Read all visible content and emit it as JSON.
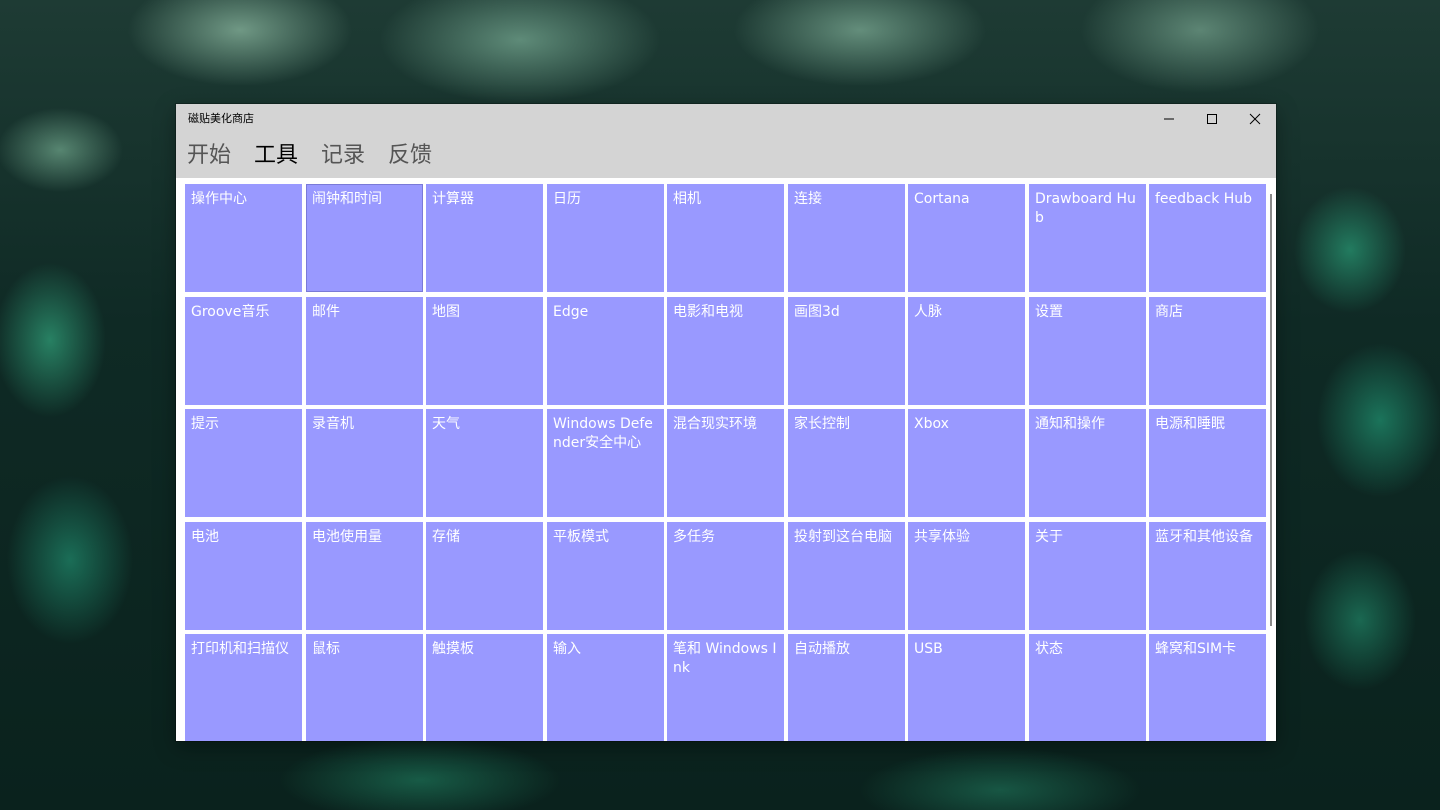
{
  "window": {
    "title": "磁贴美化商店"
  },
  "nav": {
    "tabs": [
      "开始",
      "工具",
      "记录",
      "反馈"
    ],
    "active_index": 1
  },
  "tiles": [
    [
      "操作中心",
      "闹钟和时间",
      "计算器",
      "日历",
      "相机",
      "连接",
      "Cortana",
      "Drawboard Hub",
      "feedback Hub"
    ],
    [
      "Groove音乐",
      "邮件",
      "地图",
      "Edge",
      "电影和电视",
      "画图3d",
      "人脉",
      "设置",
      "商店"
    ],
    [
      "提示",
      "录音机",
      "天气",
      "Windows Defender安全中心",
      "混合现实环境",
      "家长控制",
      "Xbox",
      "通知和操作",
      "电源和睡眠"
    ],
    [
      "电池",
      "电池使用量",
      "存储",
      "平板模式",
      "多任务",
      "投射到这台电脑",
      "共享体验",
      "关于",
      "蓝牙和其他设备"
    ],
    [
      "打印机和扫描仪",
      "鼠标",
      "触摸板",
      "输入",
      "笔和 Windows Ink",
      "自动播放",
      "USB",
      "状态",
      "蜂窝和SIM卡"
    ]
  ],
  "colors": {
    "tile": "#9999ff",
    "tile_text": "#ffffff",
    "titlebar": "#d4d4d4"
  },
  "icons": [
    "minimize-icon",
    "maximize-icon",
    "close-icon"
  ]
}
